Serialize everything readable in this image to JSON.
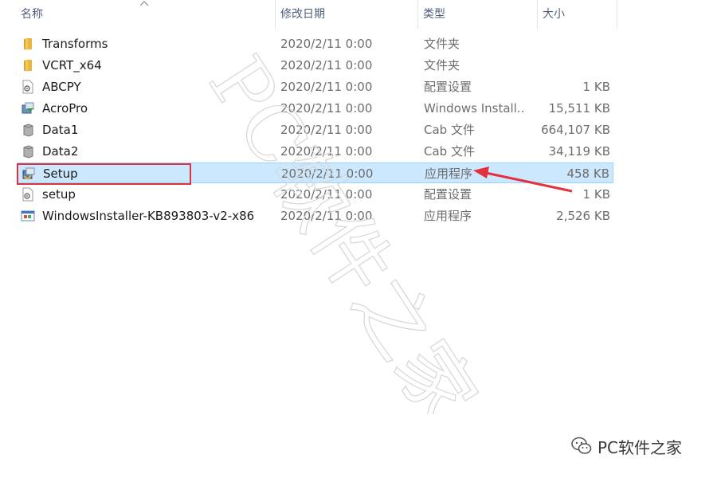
{
  "columns": [
    {
      "key": "name",
      "label": "名称"
    },
    {
      "key": "date",
      "label": "修改日期"
    },
    {
      "key": "type",
      "label": "类型"
    },
    {
      "key": "size",
      "label": "大小"
    }
  ],
  "files": [
    {
      "name": "Transforms",
      "date": "2020/2/11 0:00",
      "type": "文件夹",
      "size": "",
      "icon": "folder-icon"
    },
    {
      "name": "VCRT_x64",
      "date": "2020/2/11 0:00",
      "type": "文件夹",
      "size": "",
      "icon": "folder-icon"
    },
    {
      "name": "ABCPY",
      "date": "2020/2/11 0:00",
      "type": "配置设置",
      "size": "1 KB",
      "icon": "config-file-icon"
    },
    {
      "name": "AcroPro",
      "date": "2020/2/11 0:00",
      "type": "Windows Install...",
      "size": "15,511 KB",
      "icon": "installer-icon"
    },
    {
      "name": "Data1",
      "date": "2020/2/11 0:00",
      "type": "Cab 文件",
      "size": "664,107 KB",
      "icon": "cab-file-icon"
    },
    {
      "name": "Data2",
      "date": "2020/2/11 0:00",
      "type": "Cab 文件",
      "size": "34,119 KB",
      "icon": "cab-file-icon"
    },
    {
      "name": "Setup",
      "date": "2020/2/11 0:00",
      "type": "应用程序",
      "size": "458 KB",
      "icon": "setup-app-icon",
      "selected": true
    },
    {
      "name": "setup",
      "date": "2020/2/11 0:00",
      "type": "配置设置",
      "size": "1 KB",
      "icon": "config-file-icon"
    },
    {
      "name": "WindowsInstaller-KB893803-v2-x86",
      "date": "2020/2/11 0:00",
      "type": "应用程序",
      "size": "2,526 KB",
      "icon": "windows-app-icon"
    }
  ],
  "watermark": {
    "text": "PC软件之家"
  },
  "brand": {
    "text": "PC软件之家",
    "icon": "wechat-icon"
  },
  "colors": {
    "selection": "#cce8ff",
    "selection_border": "#99d1ff",
    "annotation": "#e2323e",
    "header_text": "#4c607a"
  }
}
